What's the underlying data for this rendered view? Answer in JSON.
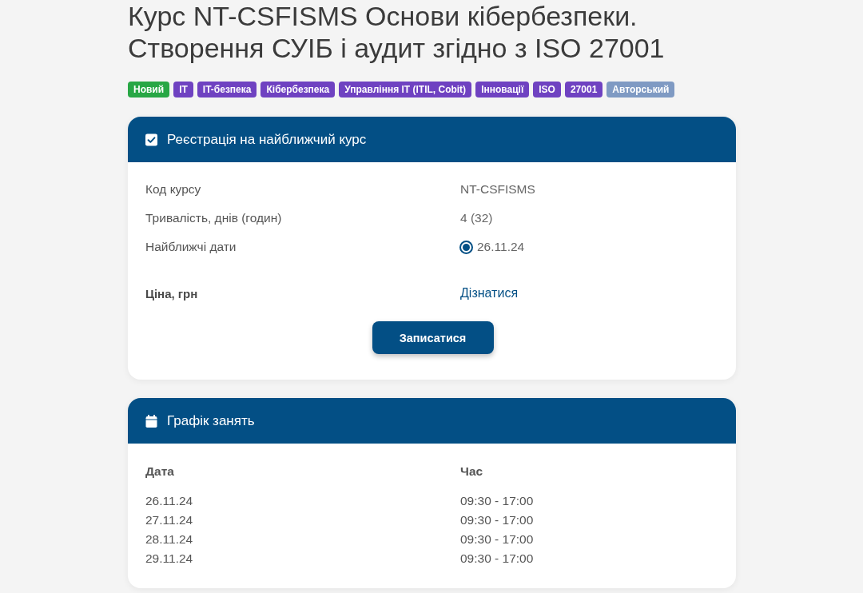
{
  "title": "Курс NT-CSFISMS Основи кібербезпеки. Створення СУІБ і аудит згідно з ISO 27001",
  "tags": [
    {
      "label": "Новий",
      "color": "#28a745"
    },
    {
      "label": "IT",
      "color": "#6f42c1"
    },
    {
      "label": "IT-безпека",
      "color": "#6f42c1"
    },
    {
      "label": "Кібербезпека",
      "color": "#6f42c1"
    },
    {
      "label": "Управління IT (ITIL, Cobit)",
      "color": "#6f42c1"
    },
    {
      "label": "Інновації",
      "color": "#6f42c1"
    },
    {
      "label": "ISO",
      "color": "#6f42c1"
    },
    {
      "label": "27001",
      "color": "#6f42c1"
    },
    {
      "label": "Авторський",
      "color": "#7f9ac3"
    }
  ],
  "registration": {
    "heading": "Реєстрація на найближчий курс",
    "rows": [
      {
        "kind": "text",
        "label": "Код курсу",
        "value": "NT-CSFISMS"
      },
      {
        "kind": "text",
        "label": "Тривалість, днів (годин)",
        "value": "4 (32)"
      },
      {
        "kind": "dates",
        "label": "Найближчі дати",
        "options": [
          {
            "label": "26.11.24",
            "selected": true
          }
        ]
      },
      {
        "kind": "link",
        "label": "Ціна, грн",
        "value": "Дізнатися"
      }
    ],
    "button": "Записатися"
  },
  "schedule": {
    "heading": "Графік занять",
    "columns": [
      "Дата",
      "Час"
    ],
    "rows": [
      [
        "26.11.24",
        "09:30 - 17:00"
      ],
      [
        "27.11.24",
        "09:30 - 17:00"
      ],
      [
        "28.11.24",
        "09:30 - 17:00"
      ],
      [
        "29.11.24",
        "09:30 - 17:00"
      ]
    ]
  }
}
